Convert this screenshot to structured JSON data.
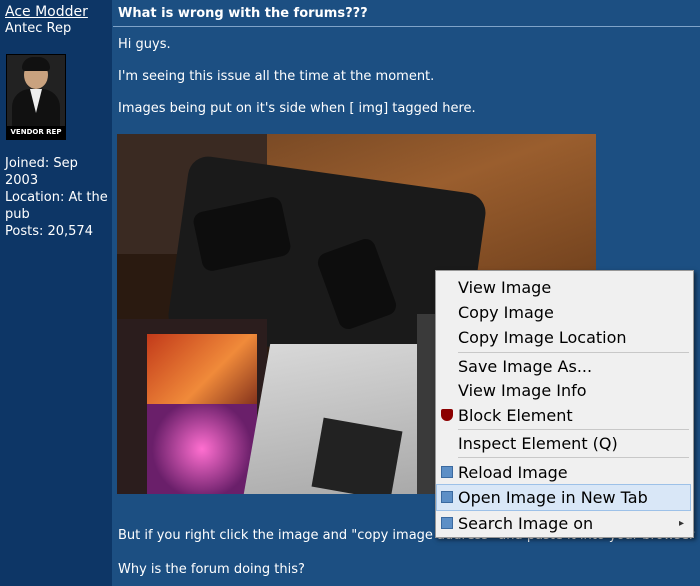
{
  "author": {
    "name": "Ace Modder",
    "title": "Antec Rep",
    "avatar_badge": "VENDOR REP",
    "joined": "Joined: Sep 2003",
    "location": "Location: At the pub",
    "posts": "Posts: 20,574"
  },
  "post": {
    "title": "What is wrong with the forums???",
    "paragraphs": [
      "Hi guys.",
      "I'm seeing this issue all the time at the moment.",
      "Images being put on it's side when [ img] tagged here.",
      "But if you right click the image and \"copy image address\" and paste it into your browser",
      "Why is the forum doing this?"
    ]
  },
  "context_menu": {
    "items": [
      {
        "label": "View Image",
        "icon": null
      },
      {
        "label": "Copy Image",
        "icon": null
      },
      {
        "label": "Copy Image Location",
        "icon": null
      },
      {
        "label": "Save Image As...",
        "icon": null
      },
      {
        "label": "View Image Info",
        "icon": null
      },
      {
        "label": "Block Element",
        "icon": "ublock-shield-icon"
      },
      {
        "label": "Inspect Element (Q)",
        "icon": null
      },
      {
        "label": "Reload Image",
        "icon": "image-icon"
      },
      {
        "label": "Open Image in New Tab",
        "icon": "image-icon",
        "highlighted": true
      },
      {
        "label": "Search Image on",
        "icon": "image-icon",
        "submenu": true
      }
    ]
  },
  "colors": {
    "page_bg": "#1c4f82",
    "sidebar_bg": "#0d3666",
    "menu_bg": "#f0f0f0",
    "highlight": "#d9e7f7"
  }
}
